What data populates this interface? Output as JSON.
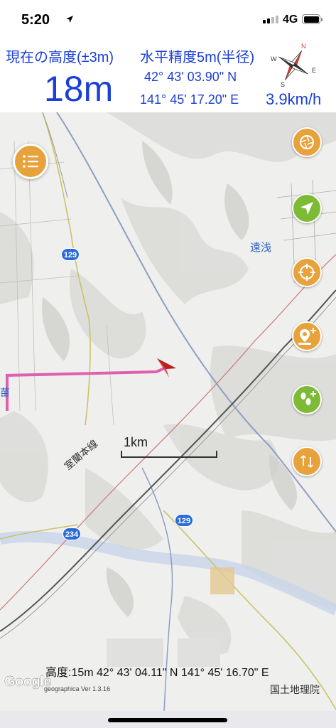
{
  "status_bar": {
    "time": "5:20",
    "network": "4G",
    "icons": [
      "location-arrow-icon",
      "signal-icon",
      "battery-icon"
    ]
  },
  "info": {
    "altitude_label": "現在の高度(±3m)",
    "altitude_value": "18m",
    "accuracy_label": "水平精度5m(半径)",
    "latitude": "42° 43' 03.90\" N",
    "longitude": "141° 45' 17.20\" E",
    "speed": "3.9km/h",
    "compass_letters": {
      "n": "N",
      "s": "S",
      "e": "E",
      "w": "W"
    }
  },
  "map": {
    "route_shields": [
      "129",
      "129",
      "234"
    ],
    "labels": {
      "town_east": "遠浅",
      "rail_line": "室蘭本線",
      "station_west": "苗"
    },
    "scale_label": "1km",
    "bottom_readout": "高度:15m  42° 43' 04.11\" N 141° 45' 16.70\" E",
    "google": "Google",
    "version": "geographica Ver 1.3.16",
    "credit": "国土地理院",
    "buttons": [
      {
        "name": "layers-button",
        "color": "#e8a23b"
      },
      {
        "name": "current-location-button",
        "color": "#7dbb36"
      },
      {
        "name": "crosshair-button",
        "color": "#e8a23b"
      },
      {
        "name": "add-marker-button",
        "color": "#e8a23b"
      },
      {
        "name": "add-track-button",
        "color": "#7dbb36"
      },
      {
        "name": "route-button",
        "color": "#e8a23b"
      }
    ]
  }
}
